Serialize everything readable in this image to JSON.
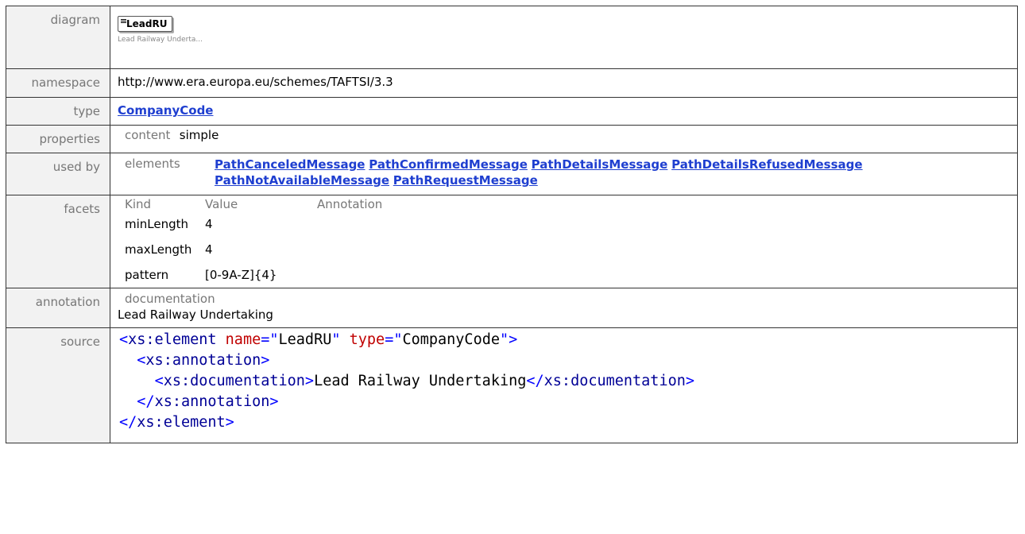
{
  "labels": {
    "diagram": "diagram",
    "namespace": "namespace",
    "type": "type",
    "properties": "properties",
    "used_by": "used by",
    "facets": "facets",
    "annotation": "annotation",
    "source": "source"
  },
  "diagram": {
    "element_name": "LeadRU",
    "note": "Lead Railway Underta..."
  },
  "namespace": "http://www.era.europa.eu/schemes/TAFTSI/3.3",
  "type": "CompanyCode",
  "properties": {
    "key": "content",
    "value": "simple"
  },
  "used_by": {
    "key": "elements",
    "items": [
      "PathCanceledMessage",
      "PathConfirmedMessage",
      "PathDetailsMessage",
      "PathDetailsRefusedMessage",
      "PathNotAvailableMessage",
      "PathRequestMessage"
    ]
  },
  "facets": {
    "headers": [
      "Kind",
      "Value",
      "Annotation"
    ],
    "rows": [
      {
        "kind": "minLength",
        "value": "4"
      },
      {
        "kind": "maxLength",
        "value": "4"
      },
      {
        "kind": "pattern",
        "value": "[0-9A-Z]{4}"
      }
    ]
  },
  "annotation": {
    "key": "documentation",
    "text": "Lead Railway Undertaking"
  },
  "source": {
    "name_attr": "LeadRU",
    "type_attr": "CompanyCode",
    "doc_text": "Lead Railway Undertaking"
  }
}
